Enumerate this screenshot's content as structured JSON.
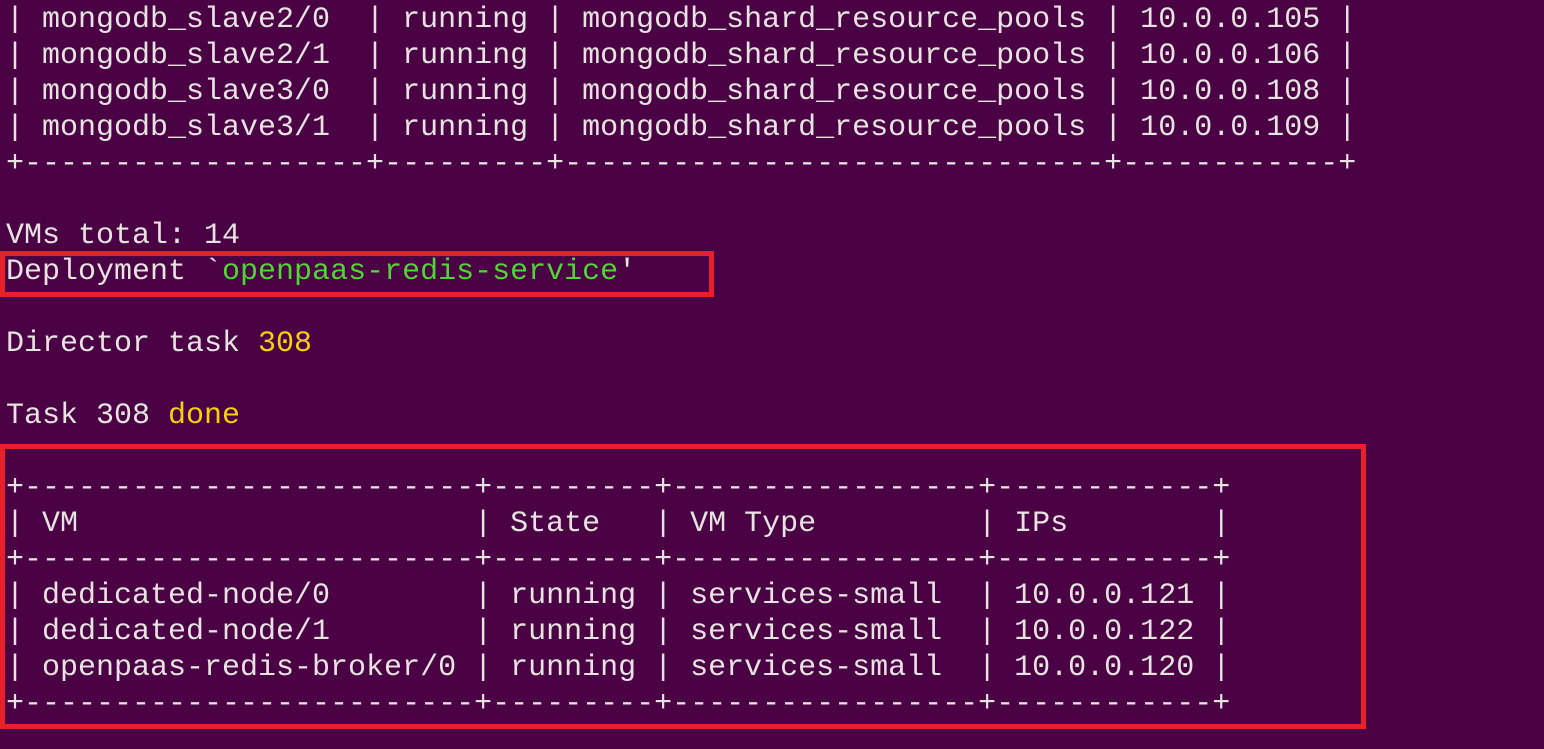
{
  "colors": {
    "background": "#4a0244",
    "text": "#e6e3e0",
    "deployment_name": "#4ed634",
    "task_number": "#f5d10a",
    "highlight_box": "#e8202a"
  },
  "top_table": {
    "rows": [
      "| mongodb_slave2/0  | running | mongodb_shard_resource_pools | 10.0.0.105 |",
      "| mongodb_slave2/1  | running | mongodb_shard_resource_pools | 10.0.0.106 |",
      "| mongodb_slave3/0  | running | mongodb_shard_resource_pools | 10.0.0.108 |",
      "| mongodb_slave3/1  | running | mongodb_shard_resource_pools | 10.0.0.109 |"
    ],
    "border": "+-------------------+---------+------------------------------+------------+"
  },
  "vms_total": "VMs total: 14",
  "deployment": {
    "prefix": "Deployment `",
    "name": "openpaas-redis-service",
    "suffix": "'"
  },
  "director_task": {
    "label": "Director task ",
    "id": "308"
  },
  "task_status": {
    "label": "Task 308 ",
    "status": "done"
  },
  "vm_table": {
    "border": "+-------------------------+---------+-----------------+------------+",
    "header": "| VM                      | State   | VM Type         | IPs        |",
    "rows": [
      "| dedicated-node/0        | running | services-small  | 10.0.0.121 |",
      "| dedicated-node/1        | running | services-small  | 10.0.0.122 |",
      "| openpaas-redis-broker/0 | running | services-small  | 10.0.0.120 |"
    ]
  }
}
